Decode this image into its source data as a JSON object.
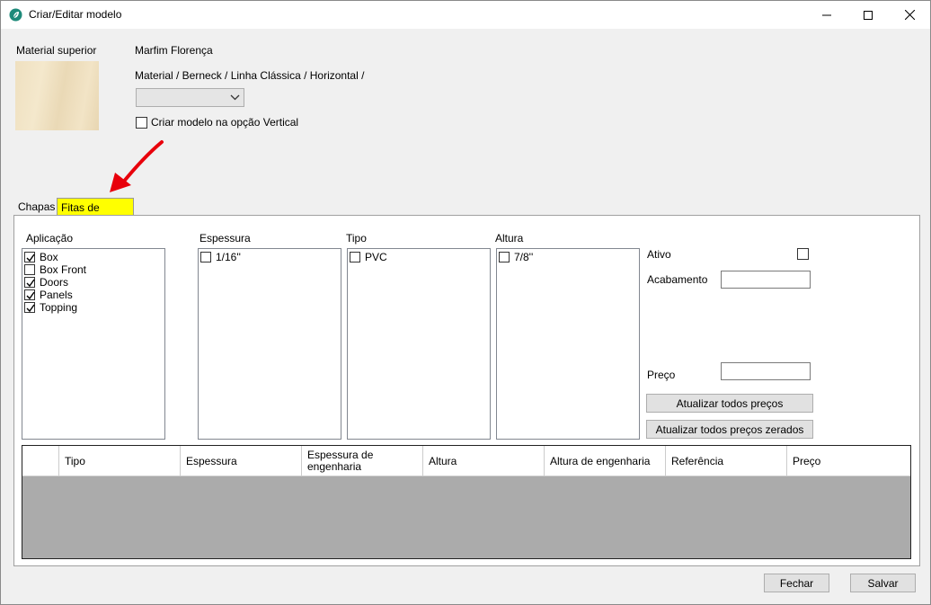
{
  "window": {
    "title": "Criar/Editar modelo",
    "icons": {
      "app": "app-leaf-icon",
      "minimize": "minimize-icon",
      "maximize": "maximize-icon",
      "close": "close-icon"
    }
  },
  "material": {
    "label": "Material superior",
    "name": "Marfim Florença",
    "path": "Material / Berneck / Linha Clássica / Horizontal /",
    "combo_value": "",
    "vertical_checkbox_label": "Criar modelo na opção  Vertical",
    "vertical_checked": false
  },
  "tabs": [
    {
      "label": "Chapas",
      "active": false
    },
    {
      "label": "Fitas de bordas",
      "active": true,
      "highlight": "#ffff00"
    }
  ],
  "annotation": {
    "icon": "red-arrow-icon",
    "color": "#e8000b"
  },
  "aplicacao": {
    "label": "Aplicação",
    "items": [
      {
        "label": "Box",
        "checked": true
      },
      {
        "label": "Box Front",
        "checked": false
      },
      {
        "label": "Doors",
        "checked": true
      },
      {
        "label": "Panels",
        "checked": true
      },
      {
        "label": "Topping",
        "checked": true
      }
    ]
  },
  "espessura": {
    "label": "Espessura",
    "items": [
      {
        "label": "1/16''",
        "checked": false
      }
    ]
  },
  "tipo": {
    "label": "Tipo",
    "items": [
      {
        "label": "PVC",
        "checked": false
      }
    ]
  },
  "altura": {
    "label": "Altura",
    "items": [
      {
        "label": "7/8''",
        "checked": false
      }
    ]
  },
  "details": {
    "ativo_label": "Ativo",
    "ativo_checked": false,
    "acabamento_label": "Acabamento",
    "acabamento_value": "",
    "preco_label": "Preço",
    "preco_value": "",
    "btn_update_all": "Atualizar todos preços",
    "btn_update_zeroed": "Atualizar todos preços zerados"
  },
  "grid": {
    "columns": [
      "",
      "Tipo",
      "Espessura",
      "Espessura de engenharia",
      "Altura",
      "Altura de engenharia",
      "Referência",
      "Preço"
    ],
    "rows": []
  },
  "footer": {
    "close_label": "Fechar",
    "save_label": "Salvar"
  }
}
